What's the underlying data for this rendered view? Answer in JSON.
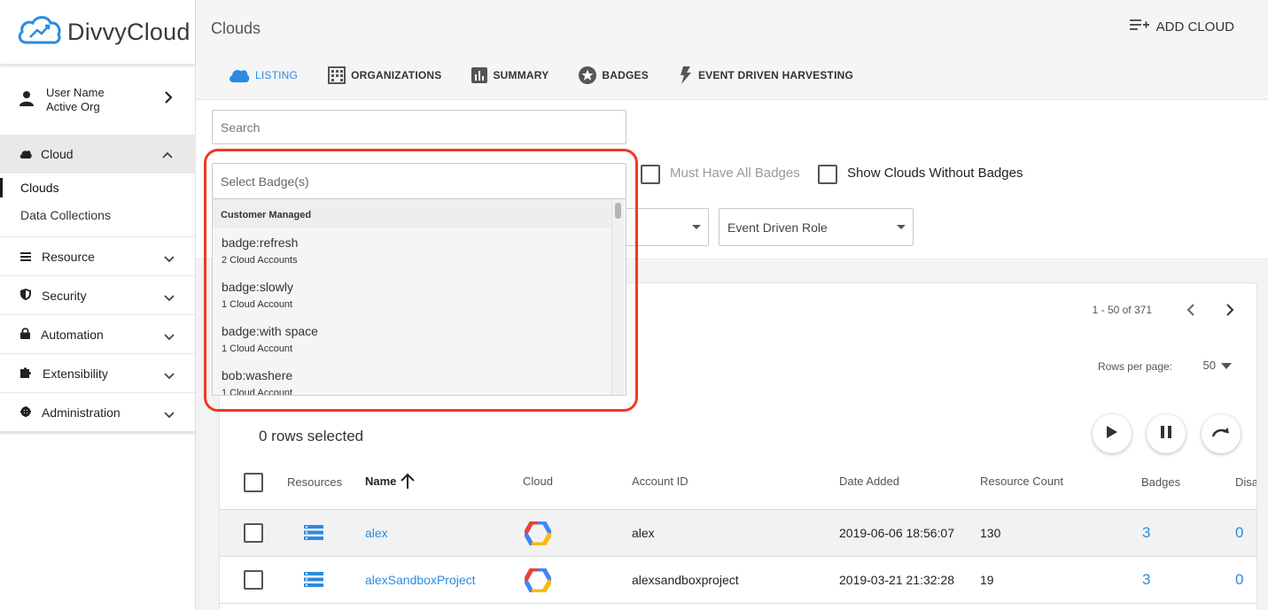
{
  "app": {
    "logo_text": "DivvyCloud"
  },
  "user": {
    "name": "User Name",
    "org": "Active Org"
  },
  "sidebar": {
    "cloud_label": "Cloud",
    "cloud_sub": [
      "Clouds",
      "Data Collections"
    ],
    "items": [
      {
        "label": "Resource",
        "icon": "list-icon"
      },
      {
        "label": "Security",
        "icon": "shield-icon"
      },
      {
        "label": "Automation",
        "icon": "lock-icon"
      },
      {
        "label": "Extensibility",
        "icon": "puzzle-icon"
      },
      {
        "label": "Administration",
        "icon": "gear-icon"
      }
    ]
  },
  "header": {
    "title": "Clouds",
    "add_cloud": "ADD CLOUD"
  },
  "tabs": [
    {
      "label": "LISTING",
      "icon": "cloud-icon",
      "active": true
    },
    {
      "label": "ORGANIZATIONS",
      "icon": "building-icon"
    },
    {
      "label": "SUMMARY",
      "icon": "bar-chart-icon"
    },
    {
      "label": "BADGES",
      "icon": "star-badge-icon"
    },
    {
      "label": "EVENT DRIVEN HARVESTING",
      "icon": "lightning-icon"
    }
  ],
  "filters": {
    "search_placeholder": "Search",
    "badge_placeholder": "Select Badge(s)",
    "must_have_all": "Must Have All Badges",
    "show_without": "Show Clouds Without Badges",
    "event_role": "Event Driven Role"
  },
  "badge_dropdown": {
    "group": "Customer Managed",
    "options": [
      {
        "title": "badge:refresh",
        "sub": "2 Cloud Accounts"
      },
      {
        "title": "badge:slowly",
        "sub": "1 Cloud Account"
      },
      {
        "title": "badge:with space",
        "sub": "1 Cloud Account"
      },
      {
        "title": "bob:washere",
        "sub": "1 Cloud Account"
      }
    ]
  },
  "table": {
    "pager": "1 - 50 of 371",
    "rows_per_page_label": "Rows per page:",
    "rows_per_page": "50",
    "rows_selected": "0 rows selected",
    "headers": {
      "resources": "Resources",
      "name": "Name",
      "cloud": "Cloud",
      "account_id": "Account ID",
      "date_added": "Date Added",
      "resource_count": "Resource Count",
      "badges": "Badges",
      "disabled": "Disa"
    },
    "rows": [
      {
        "name": "alex",
        "account_id": "alex",
        "date_added": "2019-06-06 18:56:07",
        "resource_count": "130",
        "badges": "3",
        "disabled": "0"
      },
      {
        "name": "alexSandboxProject",
        "account_id": "alexsandboxproject",
        "date_added": "2019-03-21 21:32:28",
        "resource_count": "19",
        "badges": "3",
        "disabled": "0"
      }
    ]
  },
  "colors": {
    "accent": "#2b8be0",
    "highlight": "#f23822"
  }
}
